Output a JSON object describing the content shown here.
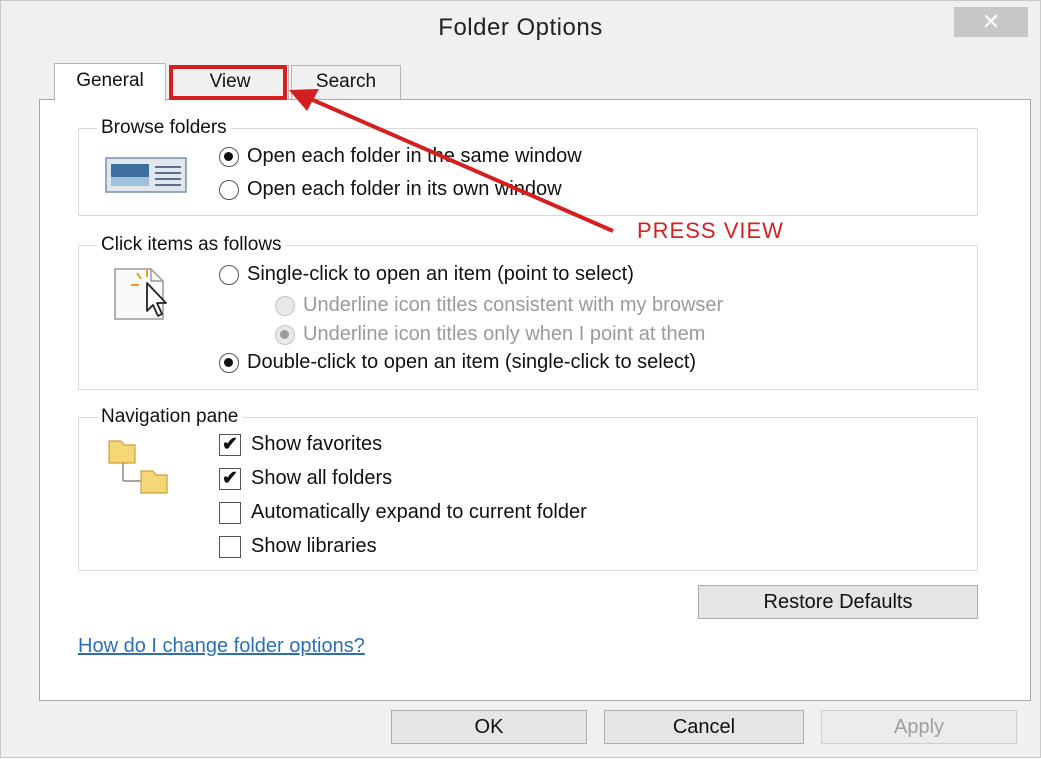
{
  "window": {
    "title": "Folder Options",
    "close_glyph": "✕"
  },
  "tabs": [
    {
      "label": "General",
      "selected": true
    },
    {
      "label": "View",
      "selected": false
    },
    {
      "label": "Search",
      "selected": false
    }
  ],
  "annotation": {
    "text": "PRESS VIEW",
    "color": "#d42020"
  },
  "browse_folders": {
    "legend": "Browse folders",
    "icon": "window-preview-icon",
    "options": [
      {
        "label": "Open each folder in the same window",
        "checked": true
      },
      {
        "label": "Open each folder in its own window",
        "checked": false
      }
    ]
  },
  "click_items": {
    "legend": "Click items as follows",
    "icon": "cursor-click-icon",
    "options": [
      {
        "label": "Single-click to open an item (point to select)",
        "checked": false,
        "enabled": true
      },
      {
        "label": "Underline icon titles consistent with my browser",
        "checked": false,
        "enabled": false
      },
      {
        "label": "Underline icon titles only when I point at them",
        "checked": true,
        "enabled": false
      },
      {
        "label": "Double-click to open an item (single-click to select)",
        "checked": true,
        "enabled": true
      }
    ]
  },
  "navigation_pane": {
    "legend": "Navigation pane",
    "icon": "folder-tree-icon",
    "options": [
      {
        "label": "Show favorites",
        "checked": true
      },
      {
        "label": "Show all folders",
        "checked": true
      },
      {
        "label": "Automatically expand to current folder",
        "checked": false
      },
      {
        "label": "Show libraries",
        "checked": false
      }
    ],
    "check_glyph": "✔"
  },
  "restore_defaults_label": "Restore Defaults",
  "help_link": "How do I change folder options?",
  "buttons": {
    "ok": "OK",
    "cancel": "Cancel",
    "apply": "Apply"
  }
}
